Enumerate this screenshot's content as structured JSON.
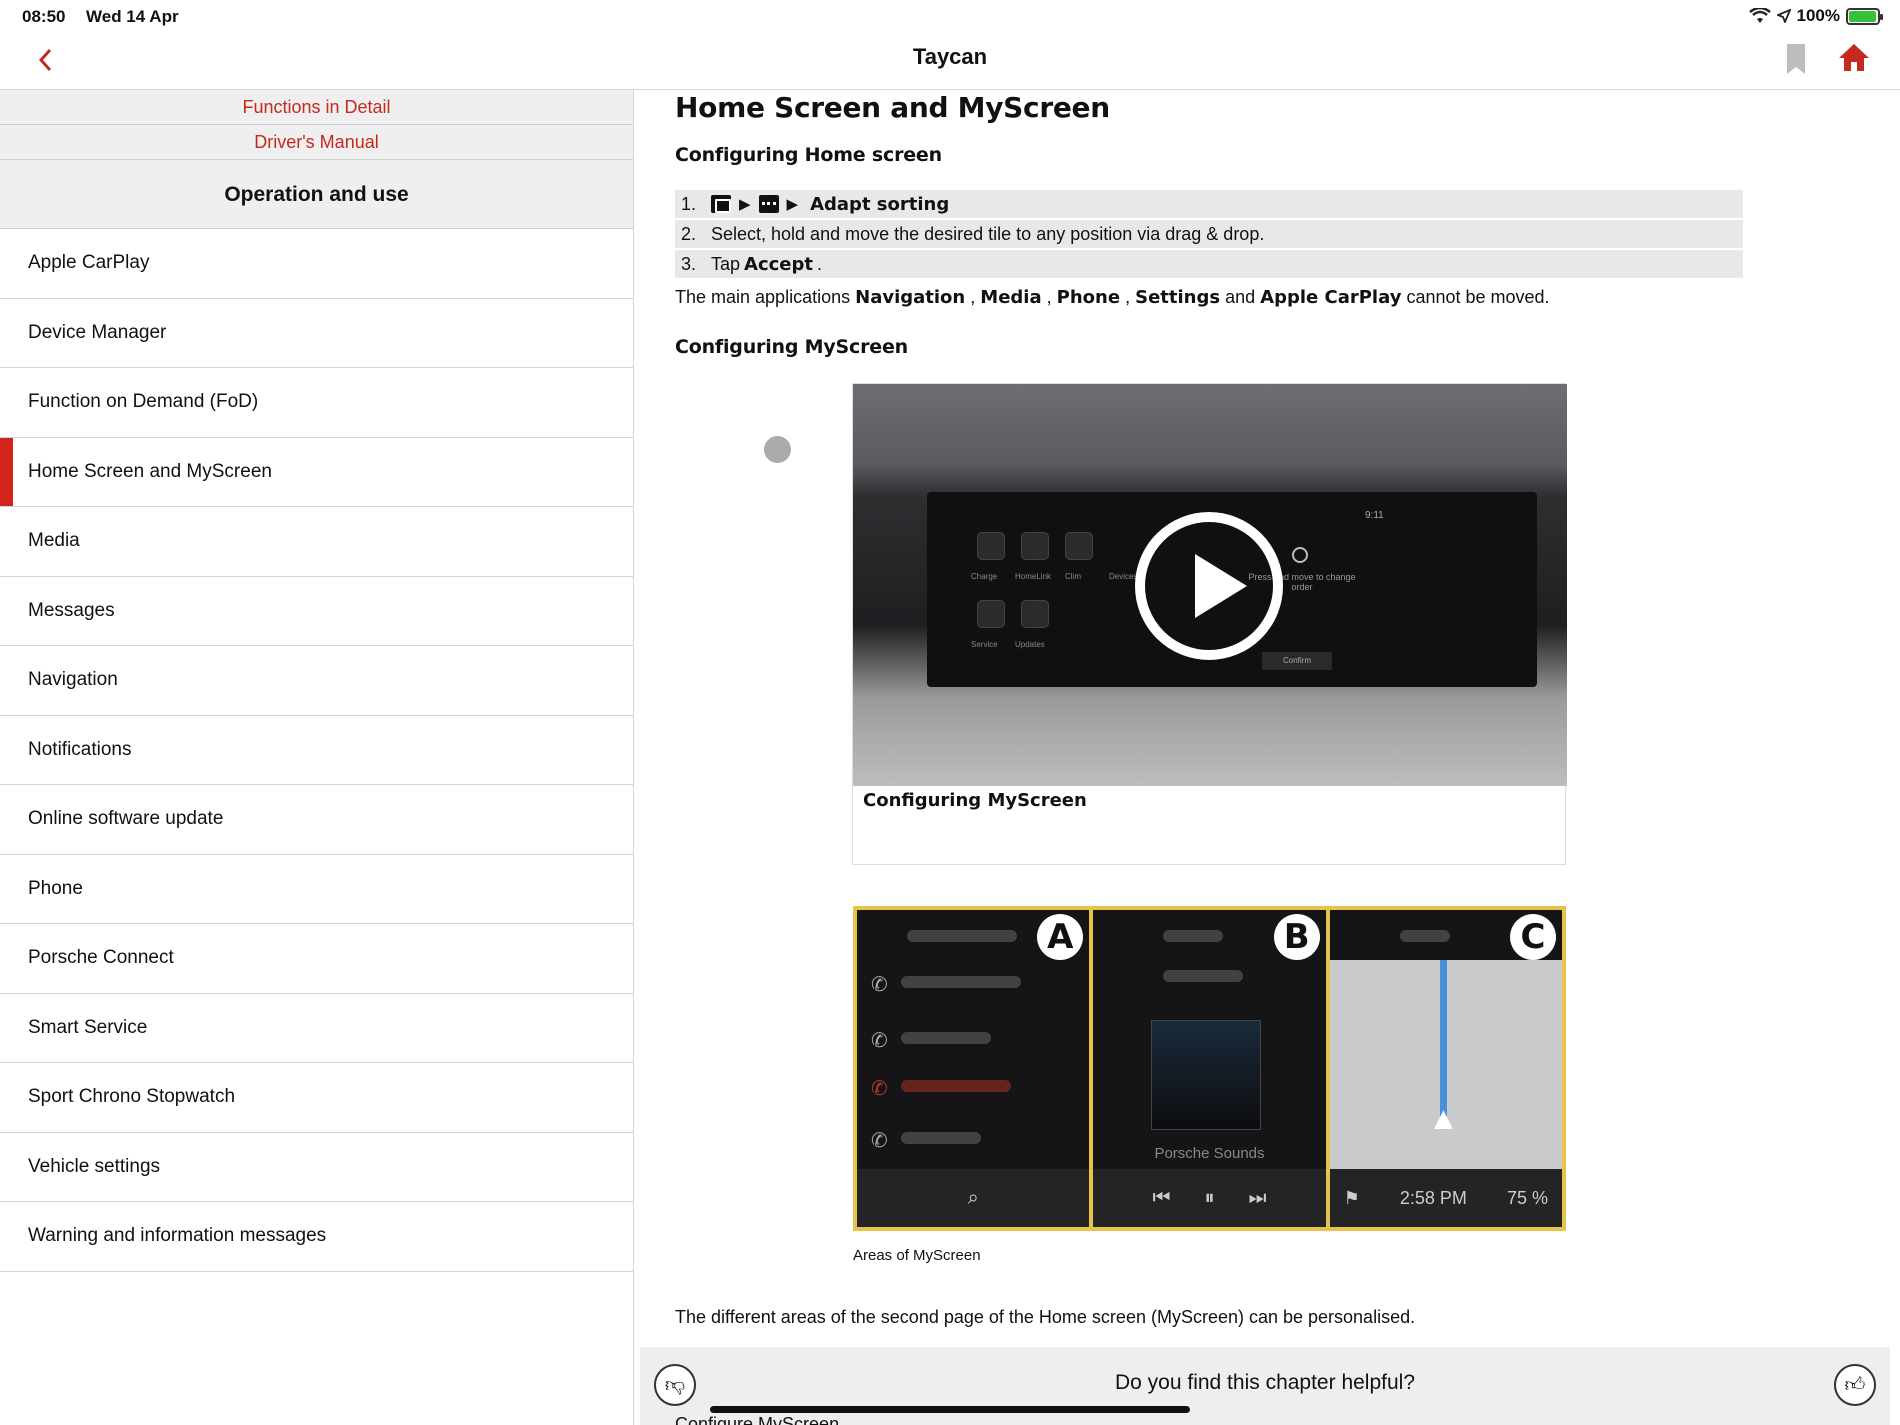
{
  "status": {
    "time": "08:50",
    "date": "Wed 14 Apr",
    "battery": "100%"
  },
  "nav": {
    "title": "Taycan"
  },
  "sidebar": {
    "crumbs": [
      "Functions in Detail",
      "Driver's Manual"
    ],
    "section": "Operation and use",
    "items": [
      "Apple CarPlay",
      "Device Manager",
      "Function on Demand (FoD)",
      "Home Screen and MyScreen",
      "Media",
      "Messages",
      "Navigation",
      "Notifications",
      "Online software update",
      "Phone",
      "Porsche Connect",
      "Smart Service",
      "Sport Chrono Stopwatch",
      "Vehicle settings",
      "Warning and information messages"
    ],
    "active_index": 3
  },
  "content": {
    "title": "Home Screen and MyScreen",
    "sub1": "Configuring Home screen",
    "step1": {
      "num": "1.",
      "action": "Adapt sorting"
    },
    "step2": {
      "num": "2.",
      "text": "Select, hold and move the desired tile to any position via drag & drop."
    },
    "step3": {
      "num": "3.",
      "pre": "Tap",
      "action": "Accept",
      "post": "."
    },
    "main_apps": {
      "pre": "The main applications",
      "a1": "Navigation",
      "a2": "Media",
      "a3": "Phone",
      "a4": "Settings",
      "a5": "Apple CarPlay",
      "sep": ",",
      "and": "and",
      "post": "cannot be moved."
    },
    "sub2": "Configuring MyScreen",
    "video": {
      "caption": "Configuring MyScreen",
      "screen_time": "9:11",
      "tiles": [
        "Charge",
        "HomeLink",
        "Clim",
        "Devices",
        "Service",
        "Updates"
      ],
      "hint": "Press and move to change order",
      "confirm": "Confirm"
    },
    "areas": {
      "badges": [
        "A",
        "B",
        "C"
      ],
      "music_label": "Porsche Sounds",
      "nav_time": "2:58 PM",
      "nav_battery": "75 %",
      "caption": "Areas of MyScreen"
    },
    "bottom_para": "The different areas of the second page of the Home screen (MyScreen) can be personalised.",
    "peek": "Configure MyScreen"
  },
  "feedback": {
    "question": "Do you find this chapter helpful?"
  },
  "colors": {
    "accent": "#c42a1e",
    "active_marker": "#d3241c",
    "frame": "#e6c34b"
  }
}
